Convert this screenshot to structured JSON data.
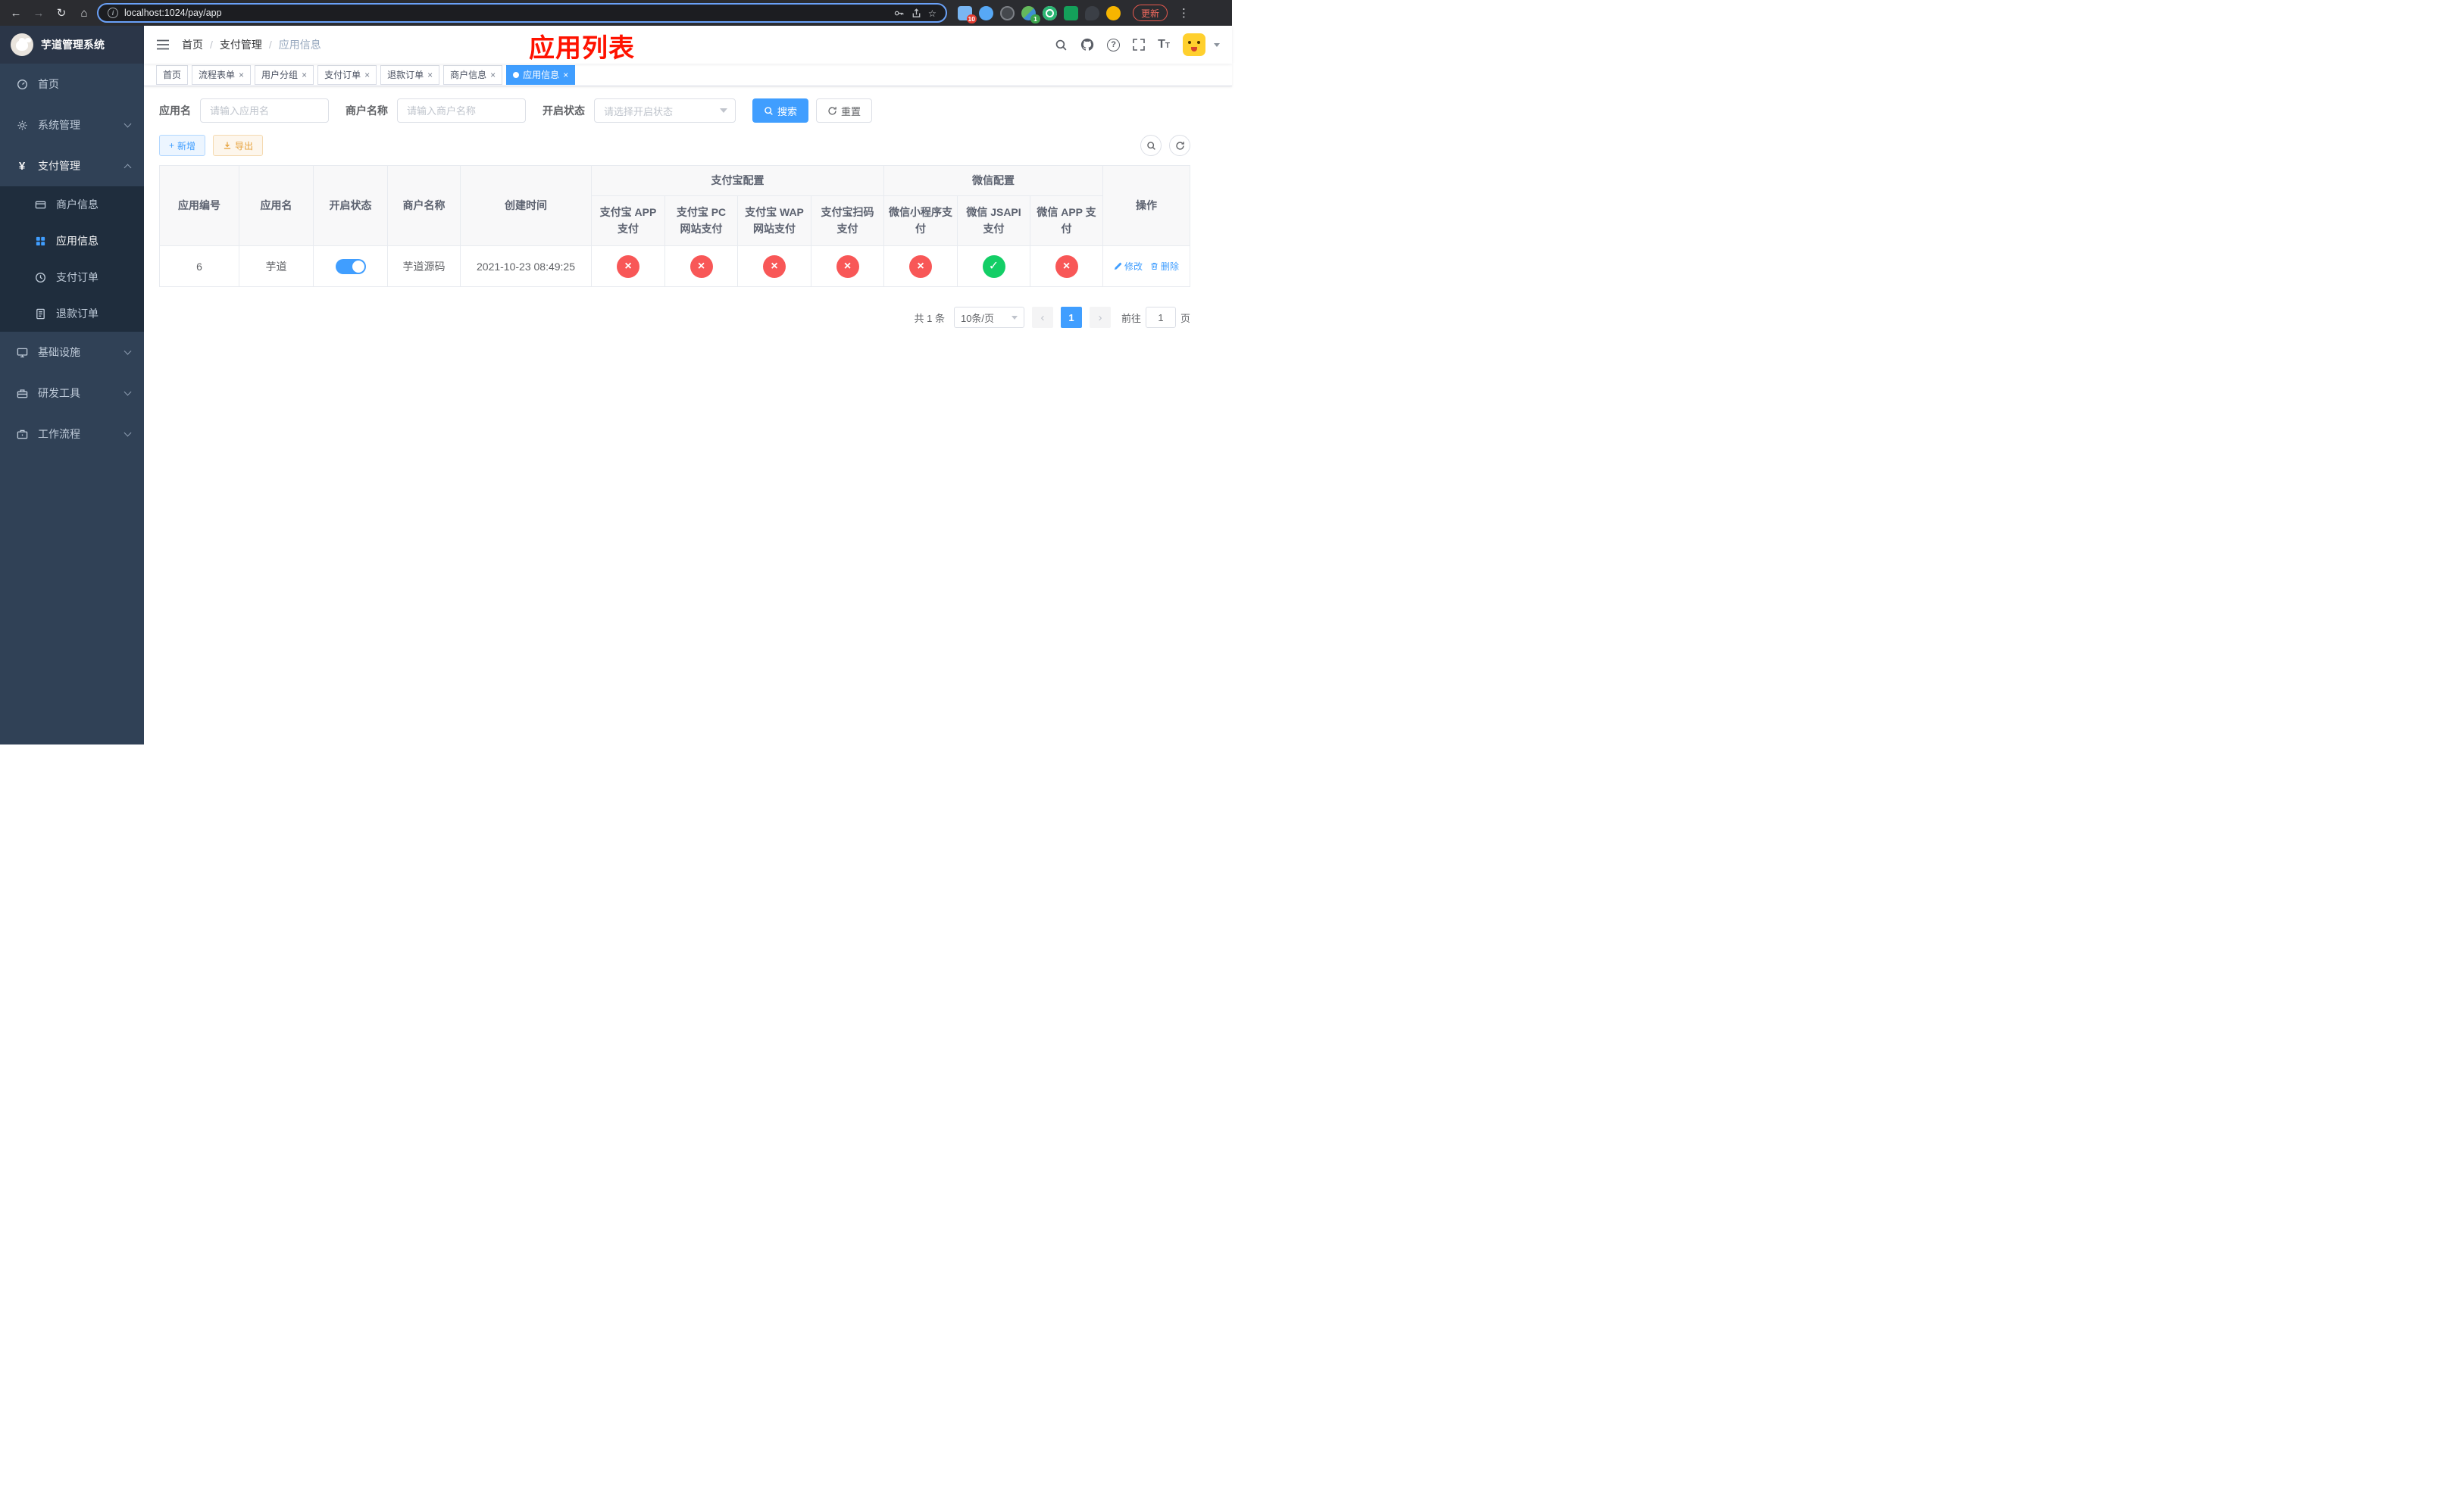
{
  "colors": {
    "accent": "#409eff",
    "success": "#13ce66",
    "danger": "#f85757",
    "warning": "#e6a23c",
    "sidebar-bg": "#304156",
    "submenu-bg": "#1f2d3d",
    "annotation": "#ff1200"
  },
  "browser": {
    "url": "localhost:1024/pay/app",
    "update_label": "更新",
    "badge_a": "10",
    "badge_b": "1"
  },
  "sidebar": {
    "title": "芋道管理系统",
    "home": "首页",
    "system": "系统管理",
    "payment": "支付管理",
    "merchant": "商户信息",
    "app_info": "应用信息",
    "pay_order": "支付订单",
    "refund_order": "退款订单",
    "infrastructure": "基础设施",
    "dev_tools": "研发工具",
    "workflow": "工作流程"
  },
  "header": {
    "breadcrumb": [
      "首页",
      "支付管理",
      "应用信息"
    ],
    "overlay_title": "应用列表"
  },
  "tabs": [
    "首页",
    "流程表单",
    "用户分组",
    "支付订单",
    "退款订单",
    "商户信息",
    "应用信息"
  ],
  "filters": {
    "app_name_label": "应用名",
    "app_name_placeholder": "请输入应用名",
    "merchant_label": "商户名称",
    "merchant_placeholder": "请输入商户名称",
    "status_label": "开启状态",
    "status_placeholder": "请选择开启状态",
    "search_label": "搜索",
    "reset_label": "重置"
  },
  "toolbar": {
    "add_label": "新增",
    "export_label": "导出"
  },
  "table": {
    "columns_main": [
      "应用编号",
      "应用名",
      "开启状态",
      "商户名称",
      "创建时间"
    ],
    "alipay_group": "支付宝配置",
    "wechat_group": "微信配置",
    "columns_alipay": [
      "支付宝 APP 支付",
      "支付宝 PC 网站支付",
      "支付宝 WAP 网站支付",
      "支付宝扫码支付"
    ],
    "columns_wechat": [
      "微信小程序支付",
      "微信 JSAPI 支付",
      "微信 APP 支付"
    ],
    "action_column": "操作",
    "row": {
      "id": "6",
      "name": "芋道",
      "enabled": true,
      "merchant": "芋道源码",
      "created": "2021-10-23 08:49:25",
      "statuses": {
        "alipay_app": false,
        "alipay_pc": false,
        "alipay_wap": false,
        "alipay_qr": false,
        "wx_mini": false,
        "wx_jsapi": true,
        "wx_app": false
      },
      "edit": "修改",
      "delete": "删除"
    }
  },
  "pagination": {
    "total": "共 1 条",
    "page_size": "10条/页",
    "page": "1",
    "goto_label": "前往",
    "goto_value": "1",
    "unit": "页"
  }
}
